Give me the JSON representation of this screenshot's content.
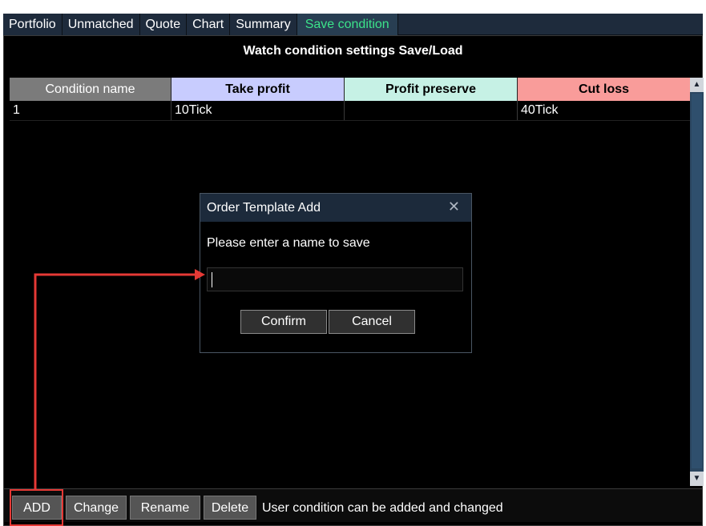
{
  "tabs": [
    {
      "label": "Portfolio"
    },
    {
      "label": "Unmatched"
    },
    {
      "label": "Quote"
    },
    {
      "label": "Chart"
    },
    {
      "label": "Summary"
    },
    {
      "label": "Save condition",
      "active": true
    }
  ],
  "panel": {
    "title": "Watch condition settings Save/Load"
  },
  "table": {
    "columns": [
      "Condition name",
      "Take profit",
      "Profit preserve",
      "Cut loss"
    ],
    "column_colors": [
      "#7b7b7b",
      "#c8ccfe",
      "#c6f1e5",
      "#f99c9a"
    ],
    "rows": [
      {
        "name": "1",
        "take_profit": "10Tick",
        "profit_preserve": "",
        "cut_loss": "40Tick"
      }
    ]
  },
  "dialog": {
    "title": "Order Template Add",
    "prompt": "Please enter a name to save",
    "input_value": "",
    "confirm_label": "Confirm",
    "cancel_label": "Cancel",
    "close_icon": "close-icon"
  },
  "toolbar": {
    "add_label": "ADD",
    "change_label": "Change",
    "rename_label": "Rename",
    "delete_label": "Delete",
    "status_text": "User condition can be added and changed"
  },
  "colors": {
    "active_tab_text": "#3ce38a",
    "annotation": "#e53935"
  }
}
